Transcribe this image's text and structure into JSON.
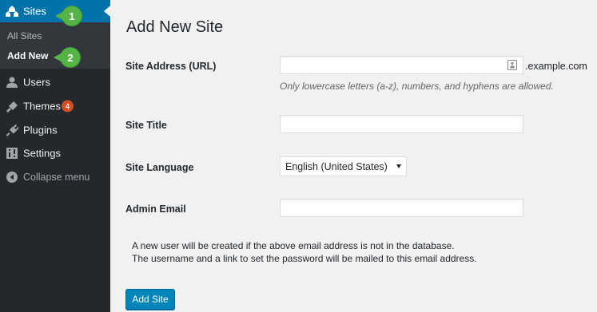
{
  "sidebar": {
    "sites": {
      "label": "Sites",
      "icon": "sites-icon"
    },
    "submenu": {
      "all_sites": "All Sites",
      "add_new": "Add New"
    },
    "items": [
      {
        "label": "Users",
        "icon": "users-icon"
      },
      {
        "label": "Themes",
        "icon": "themes-icon",
        "badge": "4"
      },
      {
        "label": "Plugins",
        "icon": "plugins-icon"
      },
      {
        "label": "Settings",
        "icon": "settings-icon"
      },
      {
        "label": "Collapse menu",
        "icon": "collapse-icon"
      }
    ],
    "callouts": [
      "1",
      "2"
    ]
  },
  "main": {
    "title": "Add New Site",
    "fields": {
      "address": {
        "label": "Site Address (URL)",
        "value": "",
        "suffix": ".example.com",
        "hint": "Only lowercase letters (a-z), numbers, and hyphens are allowed."
      },
      "title": {
        "label": "Site Title",
        "value": ""
      },
      "language": {
        "label": "Site Language",
        "selected": "English (United States)"
      },
      "email": {
        "label": "Admin Email",
        "value": ""
      }
    },
    "note": [
      "A new user will be created if the above email address is not in the database.",
      "The username and a link to set the password will be mailed to this email address."
    ],
    "submit_label": "Add Site"
  },
  "colors": {
    "sidebar_bg": "#23282d",
    "active_bg": "#0073aa",
    "submenu_bg": "#32373c",
    "page_bg": "#f1f1f1",
    "button_bg": "#0085ba",
    "badge_bg": "#d54e21",
    "callout_bg": "#56b446"
  }
}
